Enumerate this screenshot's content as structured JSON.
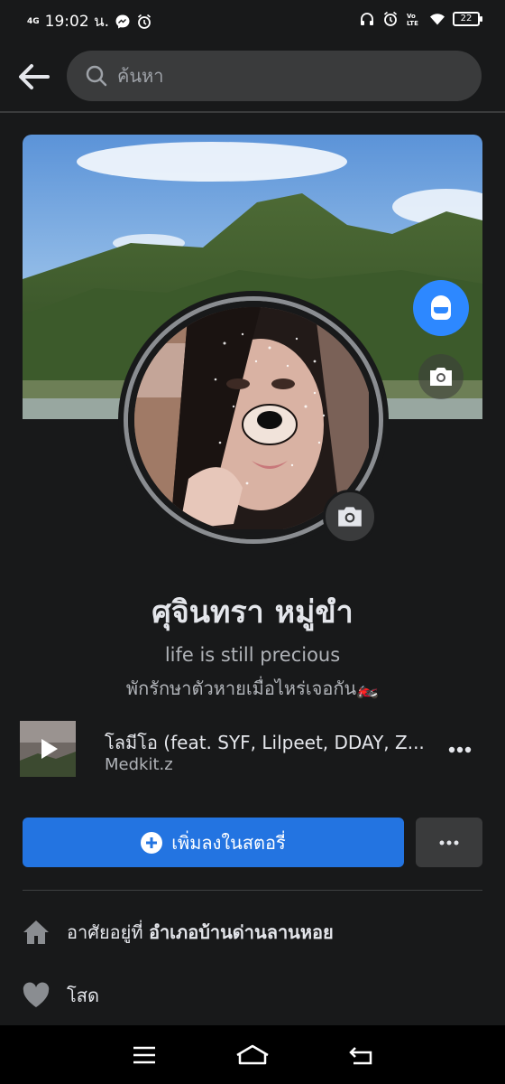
{
  "status_bar": {
    "network": "4G",
    "time": "19:02 น.",
    "battery": "22",
    "icons": [
      "messenger-icon",
      "alarm-icon",
      "headphones-icon",
      "alarm-icon",
      "volte-icon",
      "wifi-icon",
      "battery-icon"
    ]
  },
  "header": {
    "search_placeholder": "ค้นหา"
  },
  "profile": {
    "name": "ศุจินทรา หมู่ขำ",
    "bio_line1": "life is still precious",
    "bio_line2": "พักรักษาตัวหายเมื่อไหร่เจอกัน🏍️"
  },
  "music": {
    "title": "โลมีโอ (feat. SYF, Lilpeet, DDAY, Z...",
    "artist": "Medkit.z"
  },
  "actions": {
    "add_story_label": "เพิ่มลงในสตอรี่"
  },
  "details": {
    "lives_prefix": "อาศัยอยู่ที่",
    "lives_place": "อำเภอบ้านด่านลานหอย",
    "relationship": "โสด"
  },
  "colors": {
    "background": "#18191a",
    "accent": "#2374e1",
    "surface": "#3a3b3c"
  }
}
